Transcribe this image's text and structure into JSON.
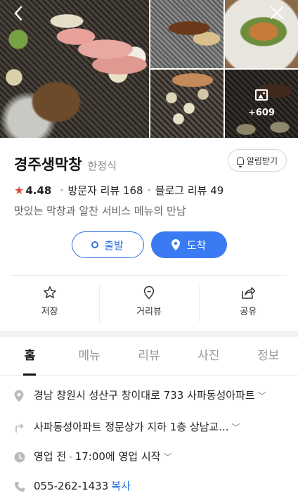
{
  "gallery": {
    "photo_count_label": "+609",
    "nav": {
      "back_icon": "chevron-left-icon",
      "close_icon": "close-icon"
    }
  },
  "place": {
    "name": "경주생막창",
    "category": "한정식",
    "alarm_label": "알림받기",
    "rating": "4.48",
    "visitor_reviews": "방문자 리뷰 168",
    "blog_reviews": "블로그 리뷰 49",
    "description": "맛있는 막창과 알찬 서비스 메뉴의 만남"
  },
  "route": {
    "start_label": "출발",
    "arrive_label": "도착"
  },
  "actions": {
    "save_label": "저장",
    "streetview_label": "거리뷰",
    "share_label": "공유"
  },
  "tabs": [
    {
      "label": "홈"
    },
    {
      "label": "메뉴"
    },
    {
      "label": "리뷰"
    },
    {
      "label": "사진"
    },
    {
      "label": "정보"
    }
  ],
  "details": {
    "address": "경남 창원시 성산구 창이대로 733 사파동성아파트",
    "directions": "사파동성아파트 정문상가 지하 1층 상남교...",
    "hours_status": "영업 전",
    "hours_next": "17:00에 영업 시작",
    "phone": "055-262-1433",
    "copy_label": "복사"
  },
  "colors": {
    "accent": "#3a7af2",
    "star": "#e34a3c"
  }
}
